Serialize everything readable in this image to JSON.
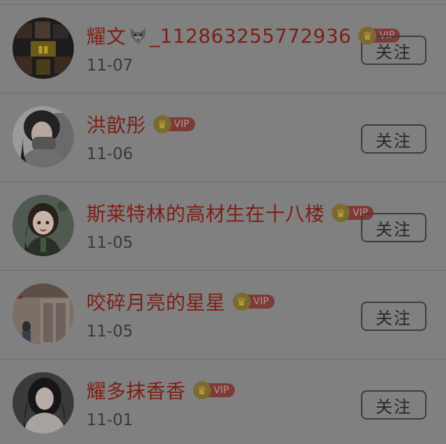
{
  "rows": [
    {
      "name": "耀文",
      "name_suffix": "_112863255772936",
      "has_wolf_emoji": true,
      "vip": "VIP",
      "date": "11-07",
      "button": "关注",
      "avatar": "avatar-collage"
    },
    {
      "name": "洪歆彤",
      "vip": "VIP",
      "date": "11-06",
      "button": "关注",
      "avatar": "avatar-girl-selfie"
    },
    {
      "name": "斯莱特林的高材生在十八楼",
      "vip": "VIP",
      "date": "11-05",
      "button": "关注",
      "avatar": "avatar-cartoon-girl"
    },
    {
      "name": "咬碎月亮的星星",
      "vip": "VIP",
      "date": "11-05",
      "button": "关注",
      "avatar": "avatar-street-photo"
    },
    {
      "name": "耀多抹香香",
      "vip": "VIP",
      "date": "11-01",
      "button": "关注",
      "avatar": "avatar-portrait-girl"
    }
  ],
  "colors": {
    "overlay_background": "#808080",
    "name_color": "#7d1f15",
    "vip_badge": "#7c3a38",
    "crown": "#7a6a30"
  }
}
